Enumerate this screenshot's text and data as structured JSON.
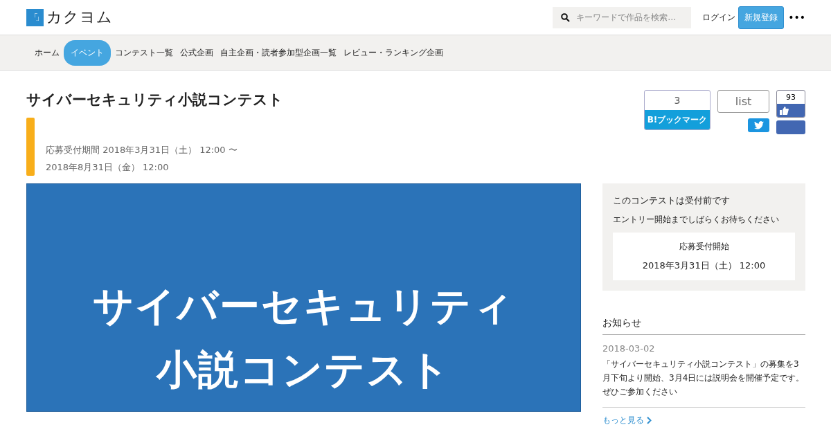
{
  "header": {
    "logo_mark": "「」",
    "logo_text": "カクヨム",
    "search": {
      "placeholder": "キーワードで作品を検索…"
    },
    "login": "ログイン",
    "signup": "新規登録",
    "more": "•••"
  },
  "nav": [
    {
      "label": "ホーム",
      "selected": false
    },
    {
      "label": "イベント",
      "selected": true
    },
    {
      "label": "コンテスト一覧",
      "selected": false
    },
    {
      "label": "公式企画",
      "selected": false
    },
    {
      "label": "自主企画・読者参加型企画一覧",
      "selected": false
    },
    {
      "label": "レビュー・ランキング企画",
      "selected": false
    }
  ],
  "event": {
    "title": "サイバーセキュリティ小説コンテスト",
    "period": "応募受付期間 2018年3月31日（土） 12:00 〜 2018年8月31日（金） 12:00"
  },
  "share": {
    "bookmark_count": "3",
    "bookmark_label": "B!ブックマーク",
    "list": "list",
    "like_count": "93"
  },
  "banner": {
    "lines": [
      "サイバーセキュリティ",
      "小説コンテスト"
    ]
  },
  "status_card": {
    "title": "このコンテストは受付前です",
    "subtitle": "エントリー開始までしばらくお待ちください",
    "label": "応募受付開始",
    "date": "2018年3月31日（土） 12:00"
  },
  "news": {
    "heading": "お知らせ",
    "items": [
      {
        "date": "2018-03-02",
        "text": "「サイバーセキュリティ小説コンテスト」の募集を3月下旬より開始、3月4日には説明会を開催予定です。ぜひご参加ください"
      }
    ],
    "more": "もっと見る"
  }
}
